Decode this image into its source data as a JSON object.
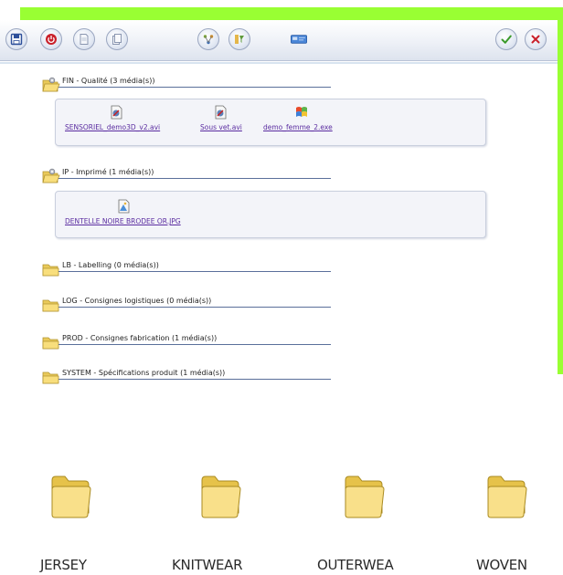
{
  "colors": {
    "accent_green": "#99ff33",
    "link": "#5a2ca0",
    "folder": "#f4d56a"
  },
  "toolbar": {
    "left_buttons": [
      "save-icon",
      "power-icon",
      "document-icon",
      "copy-icon"
    ],
    "middle_buttons": [
      "structure-icon",
      "filter-icon"
    ],
    "tag_button": "card-icon",
    "right_buttons": [
      "validate-icon",
      "cancel-icon"
    ]
  },
  "categories": [
    {
      "label": "FIN - Qualité (3 média(s))",
      "open": true,
      "media": [
        {
          "name": "SENSORIEL_demo3D_v2.avi",
          "icon": "video-icon"
        },
        {
          "name": "Sous vet.avi",
          "icon": "video-icon"
        },
        {
          "name": "demo_femme_2.exe",
          "icon": "executable-icon"
        }
      ]
    },
    {
      "label": "IP - Imprimé (1 média(s))",
      "open": true,
      "media": [
        {
          "name": "DENTELLE NOIRE BRODEE OR.JPG",
          "icon": "image-icon"
        }
      ]
    },
    {
      "label": "LB - Labelling (0 média(s))",
      "open": false
    },
    {
      "label": "LOG - Consignes logistiques (0 média(s))",
      "open": false
    },
    {
      "label": "PROD - Consignes fabrication (1 média(s))",
      "open": false
    },
    {
      "label": "SYSTEM - Spécifications produit (1 média(s))",
      "open": false
    }
  ],
  "big_folders": [
    {
      "label": "JERSEY"
    },
    {
      "label": "KNITWEAR"
    },
    {
      "label": "OUTERWEA"
    },
    {
      "label": "WOVEN"
    }
  ]
}
